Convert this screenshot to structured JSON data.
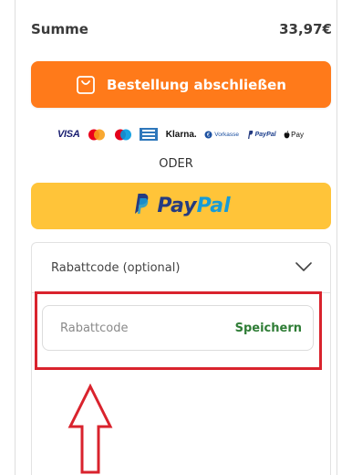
{
  "summary": {
    "label": "Summe",
    "value": "33,97€"
  },
  "checkout": {
    "label": "Bestellung abschließen",
    "icon": "shopping-bag-icon",
    "color": "#ff7a1a"
  },
  "payment_methods": {
    "visa": "VISA",
    "klarna": "Klarna.",
    "vorkasse": "Vorkasse",
    "paypal": "PayPal",
    "applepay": "Pay"
  },
  "divider_text": "ODER",
  "paypal_button": {
    "pay": "Pay",
    "pal": "Pal",
    "color": "#ffc439"
  },
  "discount": {
    "title": "Rabattcode (optional)",
    "placeholder": "Rabattcode",
    "save_label": "Speichern"
  },
  "annotation": {
    "frame_color": "#d9232d"
  }
}
